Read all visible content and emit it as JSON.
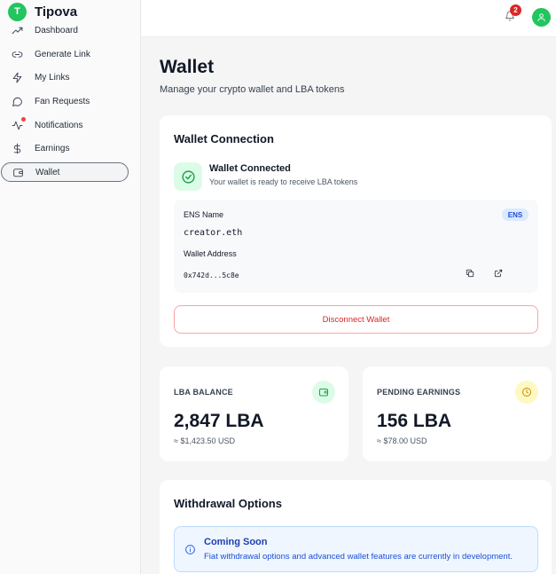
{
  "brand": {
    "logo_letter": "T",
    "name": "Tipova"
  },
  "sidebar": {
    "items": [
      {
        "label": "Dashboard",
        "icon": "trending-up-icon"
      },
      {
        "label": "Generate Link",
        "icon": "link-icon"
      },
      {
        "label": "My Links",
        "icon": "zap-icon"
      },
      {
        "label": "Fan Requests",
        "icon": "message-circle-icon"
      },
      {
        "label": "Notifications",
        "icon": "activity-icon"
      },
      {
        "label": "Earnings",
        "icon": "dollar-icon"
      },
      {
        "label": "Wallet",
        "icon": "wallet-icon",
        "active": true
      }
    ]
  },
  "topbar": {
    "notification_count": "2",
    "avatar_icon": "user-icon"
  },
  "page": {
    "title": "Wallet",
    "subtitle": "Manage your crypto wallet and LBA tokens"
  },
  "wallet_connection": {
    "title": "Wallet Connection",
    "status_title": "Wallet Connected",
    "status_sub": "Your wallet is ready to receive LBA tokens",
    "ens_label": "ENS Name",
    "ens_badge": "ENS",
    "ens_value": "creator.eth",
    "address_label": "Wallet Address",
    "address_value": "0x742d...5c8e",
    "disconnect_label": "Disconnect Wallet"
  },
  "balances": {
    "lba": {
      "label": "LBA BALANCE",
      "value": "2,847 LBA",
      "sub": "≈ $1,423.50 USD",
      "icon_bg": "#dcfce7",
      "icon_color": "#16a34a"
    },
    "pending": {
      "label": "PENDING EARNINGS",
      "value": "156 LBA",
      "sub": "≈ $78.00 USD",
      "icon_bg": "#fef9c3",
      "icon_color": "#ca8a04"
    }
  },
  "withdrawal": {
    "title": "Withdrawal Options",
    "info_title": "Coming Soon",
    "info_text": "Fiat withdrawal options and advanced wallet features are currently in development."
  },
  "colors": {
    "accent": "#22c55e",
    "danger": "#dc2626",
    "info": "#2563eb"
  }
}
